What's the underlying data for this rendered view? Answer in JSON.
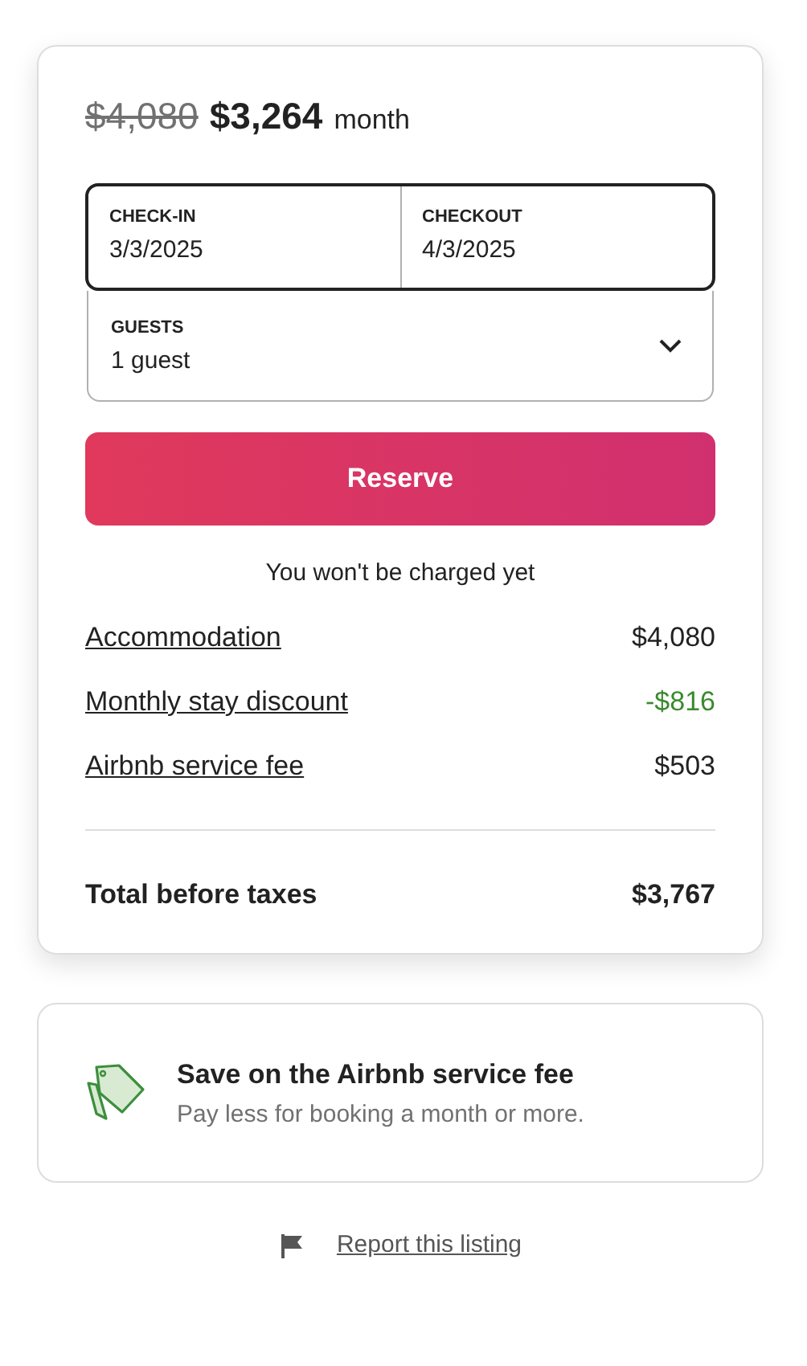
{
  "price": {
    "original": "$4,080",
    "current": "$3,264",
    "period": "month"
  },
  "dates": [
    {
      "label": "CHECK-IN",
      "value": "3/3/2025"
    },
    {
      "label": "CHECKOUT",
      "value": "4/3/2025"
    }
  ],
  "guests": {
    "label": "GUESTS",
    "value": "1 guest"
  },
  "reserve_button": "Reserve",
  "note": "You won't be charged yet",
  "line_items": [
    {
      "label": "Accommodation",
      "amount": "$4,080",
      "kind": "charge"
    },
    {
      "label": "Monthly stay discount",
      "amount": "-$816",
      "kind": "discount"
    },
    {
      "label": "Airbnb service fee",
      "amount": "$503",
      "kind": "charge"
    }
  ],
  "total": {
    "label": "Total before taxes",
    "amount": "$3,767"
  },
  "promo": {
    "title": "Save on the Airbnb service fee",
    "text": "Pay less for booking a month or more."
  },
  "report_link": "Report this listing"
}
